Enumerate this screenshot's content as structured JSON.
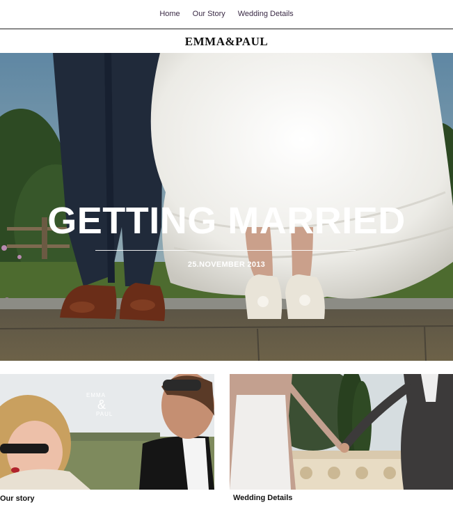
{
  "nav": {
    "items": [
      {
        "label": "Home"
      },
      {
        "label": "Our Story"
      },
      {
        "label": "Wedding Details"
      }
    ]
  },
  "brand": {
    "title": "EMMA&PAUL"
  },
  "hero": {
    "title": "GETTING MARRIED",
    "date": "25.NOVEMBER 2013"
  },
  "cards": [
    {
      "caption": "Our story",
      "watermark_top": "EMMA",
      "watermark_amp": "&",
      "watermark_bottom": "PAUL"
    },
    {
      "caption": "Wedding Details"
    }
  ],
  "colors": {
    "nav_text": "#3a2a45",
    "divider": "#222222",
    "hero_text": "#ffffff"
  }
}
